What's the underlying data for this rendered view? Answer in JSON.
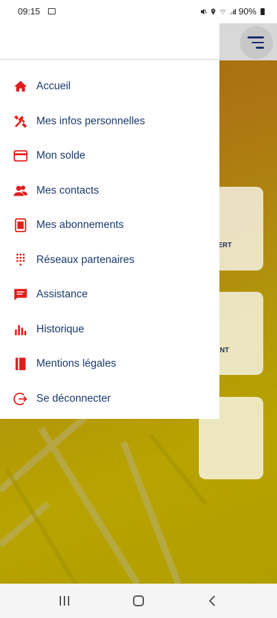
{
  "status_bar": {
    "time": "09:15",
    "battery": "90%",
    "icons": [
      "image-icon",
      "mute-icon",
      "location-icon",
      "wifi-icon",
      "signal-icon",
      "battery-icon"
    ]
  },
  "background": {
    "card_labels": [
      "ERT",
      "NT"
    ]
  },
  "drawer": {
    "items": [
      {
        "label": "Accueil",
        "icon": "home-icon"
      },
      {
        "label": "Mes infos personnelles",
        "icon": "tools-icon"
      },
      {
        "label": "Mon solde",
        "icon": "card-icon"
      },
      {
        "label": "Mes contacts",
        "icon": "contacts-icon"
      },
      {
        "label": "Mes abonnements",
        "icon": "subscription-icon"
      },
      {
        "label": "Réseaux partenaires",
        "icon": "dots-grid-icon"
      },
      {
        "label": "Assistance",
        "icon": "chat-icon"
      },
      {
        "label": "Historique",
        "icon": "bar-chart-icon"
      },
      {
        "label": "Mentions légales",
        "icon": "book-icon"
      },
      {
        "label": "Se déconnecter",
        "icon": "logout-icon"
      }
    ]
  },
  "colors": {
    "icon_red": "#e01e1e",
    "label_blue": "#1a3a6e",
    "menu_button_blue": "#1a2a6c",
    "background_yellow": "#ffe200"
  }
}
